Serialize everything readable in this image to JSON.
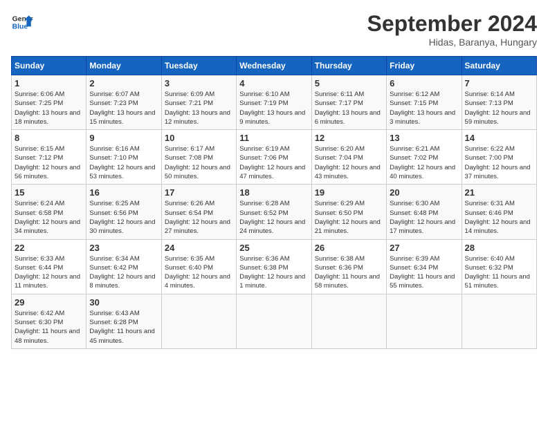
{
  "logo": {
    "line1": "General",
    "line2": "Blue"
  },
  "title": "September 2024",
  "location": "Hidas, Baranya, Hungary",
  "days_of_week": [
    "Sunday",
    "Monday",
    "Tuesday",
    "Wednesday",
    "Thursday",
    "Friday",
    "Saturday"
  ],
  "weeks": [
    [
      {
        "num": "1",
        "sunrise": "Sunrise: 6:06 AM",
        "sunset": "Sunset: 7:25 PM",
        "daylight": "Daylight: 13 hours and 18 minutes."
      },
      {
        "num": "2",
        "sunrise": "Sunrise: 6:07 AM",
        "sunset": "Sunset: 7:23 PM",
        "daylight": "Daylight: 13 hours and 15 minutes."
      },
      {
        "num": "3",
        "sunrise": "Sunrise: 6:09 AM",
        "sunset": "Sunset: 7:21 PM",
        "daylight": "Daylight: 13 hours and 12 minutes."
      },
      {
        "num": "4",
        "sunrise": "Sunrise: 6:10 AM",
        "sunset": "Sunset: 7:19 PM",
        "daylight": "Daylight: 13 hours and 9 minutes."
      },
      {
        "num": "5",
        "sunrise": "Sunrise: 6:11 AM",
        "sunset": "Sunset: 7:17 PM",
        "daylight": "Daylight: 13 hours and 6 minutes."
      },
      {
        "num": "6",
        "sunrise": "Sunrise: 6:12 AM",
        "sunset": "Sunset: 7:15 PM",
        "daylight": "Daylight: 13 hours and 3 minutes."
      },
      {
        "num": "7",
        "sunrise": "Sunrise: 6:14 AM",
        "sunset": "Sunset: 7:13 PM",
        "daylight": "Daylight: 12 hours and 59 minutes."
      }
    ],
    [
      {
        "num": "8",
        "sunrise": "Sunrise: 6:15 AM",
        "sunset": "Sunset: 7:12 PM",
        "daylight": "Daylight: 12 hours and 56 minutes."
      },
      {
        "num": "9",
        "sunrise": "Sunrise: 6:16 AM",
        "sunset": "Sunset: 7:10 PM",
        "daylight": "Daylight: 12 hours and 53 minutes."
      },
      {
        "num": "10",
        "sunrise": "Sunrise: 6:17 AM",
        "sunset": "Sunset: 7:08 PM",
        "daylight": "Daylight: 12 hours and 50 minutes."
      },
      {
        "num": "11",
        "sunrise": "Sunrise: 6:19 AM",
        "sunset": "Sunset: 7:06 PM",
        "daylight": "Daylight: 12 hours and 47 minutes."
      },
      {
        "num": "12",
        "sunrise": "Sunrise: 6:20 AM",
        "sunset": "Sunset: 7:04 PM",
        "daylight": "Daylight: 12 hours and 43 minutes."
      },
      {
        "num": "13",
        "sunrise": "Sunrise: 6:21 AM",
        "sunset": "Sunset: 7:02 PM",
        "daylight": "Daylight: 12 hours and 40 minutes."
      },
      {
        "num": "14",
        "sunrise": "Sunrise: 6:22 AM",
        "sunset": "Sunset: 7:00 PM",
        "daylight": "Daylight: 12 hours and 37 minutes."
      }
    ],
    [
      {
        "num": "15",
        "sunrise": "Sunrise: 6:24 AM",
        "sunset": "Sunset: 6:58 PM",
        "daylight": "Daylight: 12 hours and 34 minutes."
      },
      {
        "num": "16",
        "sunrise": "Sunrise: 6:25 AM",
        "sunset": "Sunset: 6:56 PM",
        "daylight": "Daylight: 12 hours and 30 minutes."
      },
      {
        "num": "17",
        "sunrise": "Sunrise: 6:26 AM",
        "sunset": "Sunset: 6:54 PM",
        "daylight": "Daylight: 12 hours and 27 minutes."
      },
      {
        "num": "18",
        "sunrise": "Sunrise: 6:28 AM",
        "sunset": "Sunset: 6:52 PM",
        "daylight": "Daylight: 12 hours and 24 minutes."
      },
      {
        "num": "19",
        "sunrise": "Sunrise: 6:29 AM",
        "sunset": "Sunset: 6:50 PM",
        "daylight": "Daylight: 12 hours and 21 minutes."
      },
      {
        "num": "20",
        "sunrise": "Sunrise: 6:30 AM",
        "sunset": "Sunset: 6:48 PM",
        "daylight": "Daylight: 12 hours and 17 minutes."
      },
      {
        "num": "21",
        "sunrise": "Sunrise: 6:31 AM",
        "sunset": "Sunset: 6:46 PM",
        "daylight": "Daylight: 12 hours and 14 minutes."
      }
    ],
    [
      {
        "num": "22",
        "sunrise": "Sunrise: 6:33 AM",
        "sunset": "Sunset: 6:44 PM",
        "daylight": "Daylight: 12 hours and 11 minutes."
      },
      {
        "num": "23",
        "sunrise": "Sunrise: 6:34 AM",
        "sunset": "Sunset: 6:42 PM",
        "daylight": "Daylight: 12 hours and 8 minutes."
      },
      {
        "num": "24",
        "sunrise": "Sunrise: 6:35 AM",
        "sunset": "Sunset: 6:40 PM",
        "daylight": "Daylight: 12 hours and 4 minutes."
      },
      {
        "num": "25",
        "sunrise": "Sunrise: 6:36 AM",
        "sunset": "Sunset: 6:38 PM",
        "daylight": "Daylight: 12 hours and 1 minute."
      },
      {
        "num": "26",
        "sunrise": "Sunrise: 6:38 AM",
        "sunset": "Sunset: 6:36 PM",
        "daylight": "Daylight: 11 hours and 58 minutes."
      },
      {
        "num": "27",
        "sunrise": "Sunrise: 6:39 AM",
        "sunset": "Sunset: 6:34 PM",
        "daylight": "Daylight: 11 hours and 55 minutes."
      },
      {
        "num": "28",
        "sunrise": "Sunrise: 6:40 AM",
        "sunset": "Sunset: 6:32 PM",
        "daylight": "Daylight: 11 hours and 51 minutes."
      }
    ],
    [
      {
        "num": "29",
        "sunrise": "Sunrise: 6:42 AM",
        "sunset": "Sunset: 6:30 PM",
        "daylight": "Daylight: 11 hours and 48 minutes."
      },
      {
        "num": "30",
        "sunrise": "Sunrise: 6:43 AM",
        "sunset": "Sunset: 6:28 PM",
        "daylight": "Daylight: 11 hours and 45 minutes."
      },
      null,
      null,
      null,
      null,
      null
    ]
  ]
}
